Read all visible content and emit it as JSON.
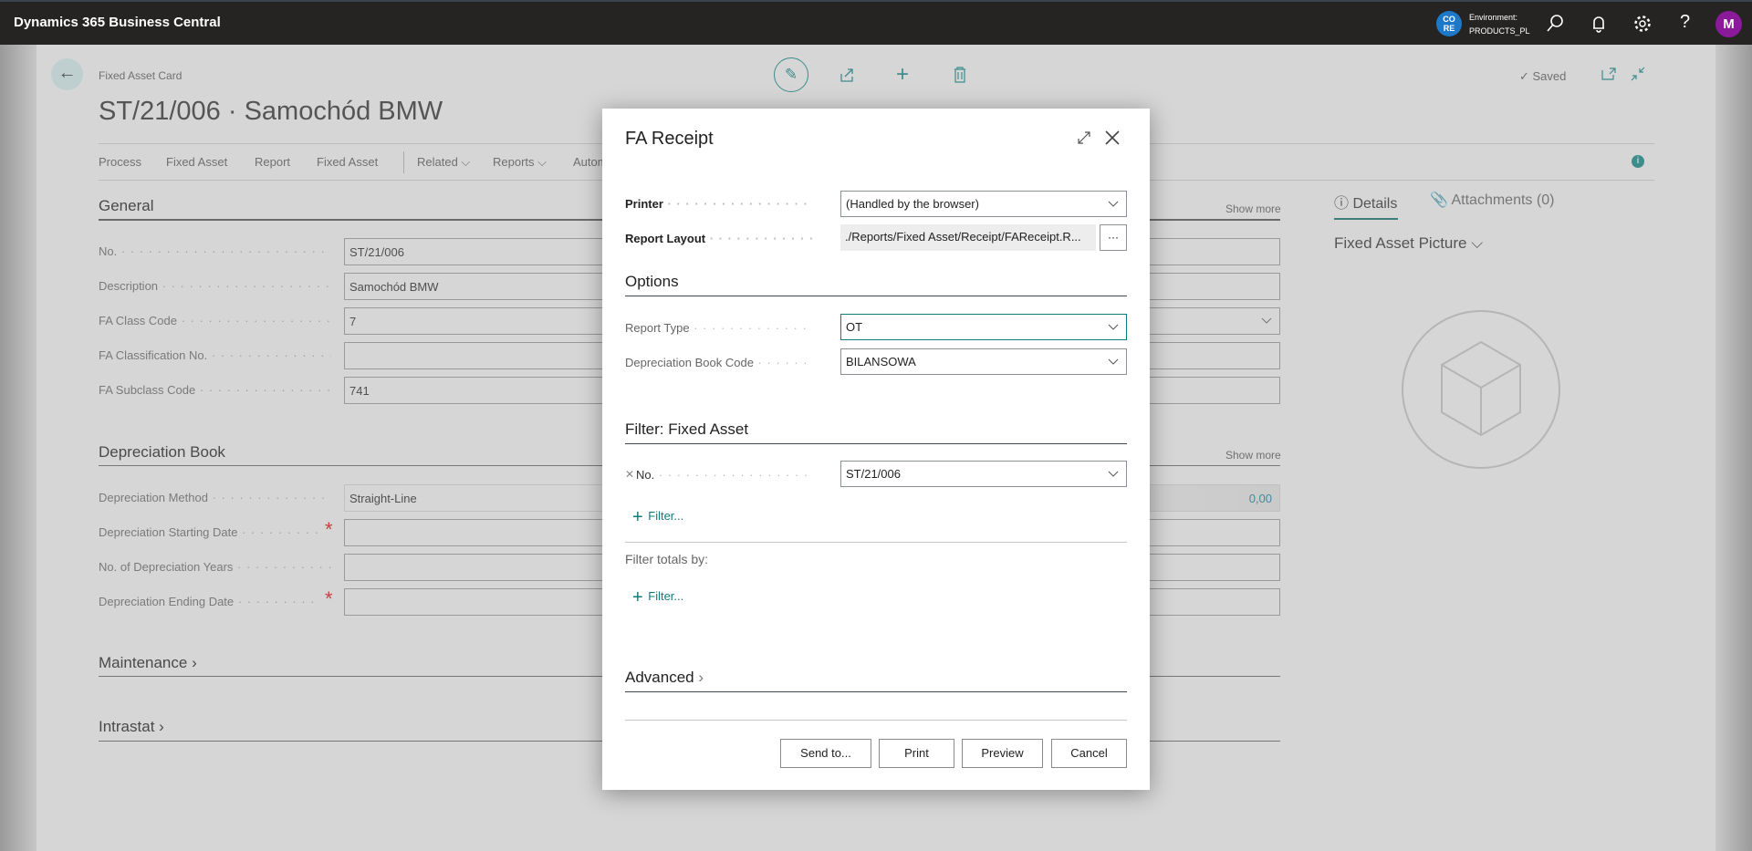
{
  "topbar": {
    "app_title": "Dynamics 365 Business Central",
    "env_badge": "CO RE",
    "env_label": "Environment:",
    "env_name": "PRODUCTS_PL",
    "avatar": "M",
    "icons": [
      "search-icon",
      "bell-icon",
      "gear-icon",
      "help-icon"
    ]
  },
  "page": {
    "breadcrumb": "Fixed Asset Card",
    "title": "ST/21/006 · Samochód BMW",
    "saved": "Saved",
    "actions": [
      "Process",
      "Fixed Asset",
      "Report",
      "Fixed Asset",
      "Related",
      "Reports",
      "Autom"
    ],
    "general": {
      "heading": "General",
      "show_more": "Show more",
      "fields": [
        {
          "label": "No.",
          "value": "ST/21/006"
        },
        {
          "label": "Description",
          "value": "Samochód BMW"
        },
        {
          "label": "FA Class Code",
          "value": "7"
        },
        {
          "label": "FA Classification No.",
          "value": ""
        },
        {
          "label": "FA Subclass Code",
          "value": "741"
        }
      ]
    },
    "depreciation": {
      "heading": "Depreciation Book",
      "show_more": "Show more",
      "fields": [
        {
          "label": "Depreciation Method",
          "value": "Straight-Line"
        },
        {
          "label": "Depreciation Starting Date",
          "value": ""
        },
        {
          "label": "No. of Depreciation Years",
          "value": ""
        },
        {
          "label": "Depreciation Ending Date",
          "value": ""
        }
      ],
      "amount": "0,00"
    },
    "maintenance": "Maintenance",
    "intrastat": "Intrastat",
    "factbox": {
      "tab_details": "Details",
      "tab_attachments": "Attachments (0)",
      "picture_heading": "Fixed Asset Picture"
    }
  },
  "dialog": {
    "title": "FA Receipt",
    "printer_label": "Printer",
    "printer_value": "(Handled by the browser)",
    "layout_label": "Report Layout",
    "layout_value": "./Reports/Fixed Asset/Receipt/FAReceipt.R...",
    "layout_button": "···",
    "options_heading": "Options",
    "report_type_label": "Report Type",
    "report_type_value": "OT",
    "dep_book_label": "Depreciation Book Code",
    "dep_book_value": "BILANSOWA",
    "filter_heading": "Filter: Fixed Asset",
    "filter_no_label": "No.",
    "filter_no_value": "ST/21/006",
    "add_filter": "Filter...",
    "filter_totals": "Filter totals by:",
    "add_filter2": "Filter...",
    "advanced": "Advanced",
    "buttons": {
      "send_to": "Send to...",
      "print": "Print",
      "preview": "Preview",
      "cancel": "Cancel"
    }
  },
  "colors": {
    "accent": "#0f7b7b",
    "topbar": "#252423",
    "avatar": "#8b1a9a",
    "env_badge": "#1e78c8",
    "required": "#c84040"
  }
}
